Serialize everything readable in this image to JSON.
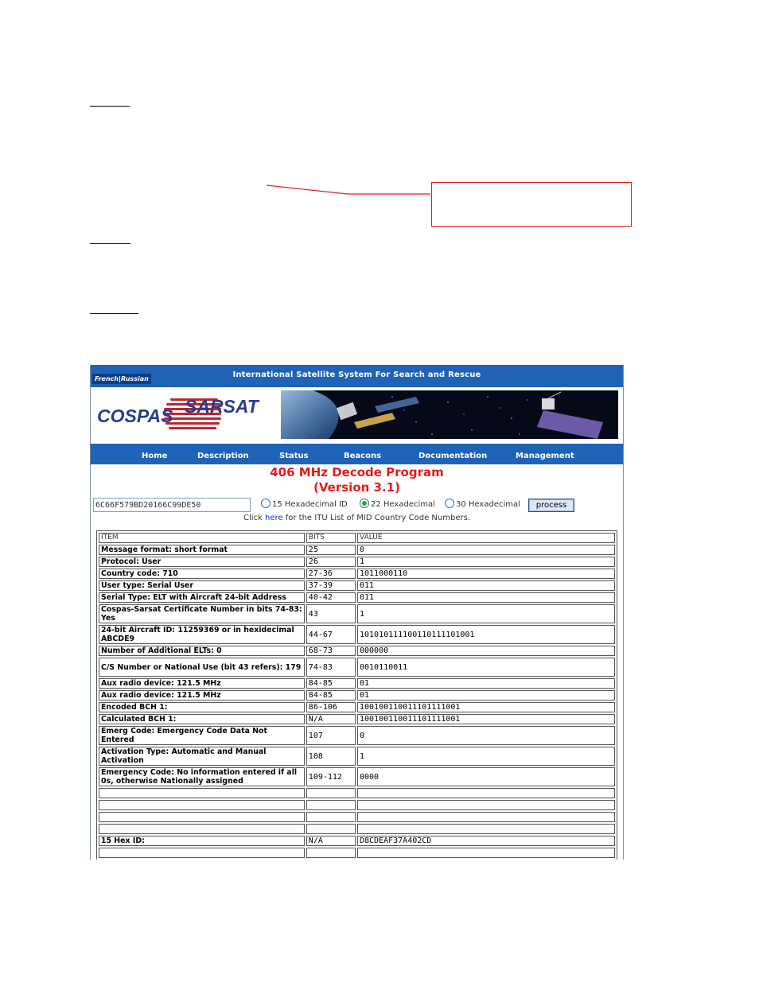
{
  "screenshot": {
    "topbar": {
      "lang_links": [
        "French",
        "Russian"
      ],
      "title": "International Satellite System For Search and Rescue"
    },
    "logo": {
      "left": "COSPAS",
      "right": "SARSAT"
    },
    "nav": [
      "Home",
      "Description",
      "Status",
      "Beacons",
      "Documentation",
      "Management"
    ],
    "heading": {
      "line1": "406 MHz Decode Program",
      "line2": "(Version 3.1)"
    },
    "form": {
      "hex_value": "6C66F579BD20166C99DE50",
      "options": [
        {
          "label": "15 Hexadecimal ID",
          "selected": false
        },
        {
          "label": "22 Hexadecimal",
          "selected": true
        },
        {
          "label": "30 Hexadecimal",
          "selected": false
        }
      ],
      "process_label": "process"
    },
    "click_note": {
      "before": "Click ",
      "link": "here",
      "after": " for the ITU List of MID Country Code Numbers."
    },
    "table": {
      "headers": [
        "ITEM",
        "BITS",
        "VALUE"
      ],
      "rows": [
        [
          "Message format: short format",
          "25",
          "0"
        ],
        [
          "Protocol: User",
          "26",
          "1"
        ],
        [
          "Country code: 710",
          "27-36",
          "1011000110"
        ],
        [
          "User type: Serial User",
          "37-39",
          "011"
        ],
        [
          "Serial Type: ELT with Aircraft 24-bit Address",
          "40-42",
          "011"
        ],
        [
          "Cospas-Sarsat Certificate Number in bits 74-83: Yes",
          "43",
          "1"
        ],
        [
          "24-bit Aircraft ID: 11259369 or in hexidecimal ABCDE9",
          "44-67",
          "101010111100110111101001"
        ],
        [
          "Number of Additional ELTs: 0",
          "68-73",
          "000000"
        ],
        [
          "C/S Number or National Use (bit 43 refers): 179",
          "74-83",
          "0010110011"
        ],
        [
          "Aux radio device: 121.5 MHz",
          "84-85",
          "01"
        ],
        [
          "Aux radio device: 121.5 MHz",
          "84-85",
          "01"
        ],
        [
          "Encoded BCH 1:",
          "86-106",
          "100100110011101111001"
        ],
        [
          "Calculated BCH 1:",
          "N/A",
          "100100110011101111001"
        ],
        [
          "Emerg Code: Emergency Code Data Not Entered",
          "107",
          "0"
        ],
        [
          "Activation Type: Automatic and Manual Activation",
          "108",
          "1"
        ],
        [
          "Emergency Code: No information entered if all 0s, otherwise Nationally assigned",
          "109-112",
          "0000"
        ],
        [
          "",
          "",
          ""
        ],
        [
          "",
          "",
          ""
        ],
        [
          "",
          "",
          ""
        ],
        [
          "",
          "",
          ""
        ],
        [
          "15 Hex ID:",
          "N/A",
          "D8CDEAF37A402CD"
        ],
        [
          "",
          "",
          ""
        ]
      ]
    }
  },
  "colors": {
    "bar_blue": "#1f63b8",
    "title_red": "#e31b1b",
    "callout_red": "#e02020",
    "link_blue": "#1133cc"
  }
}
